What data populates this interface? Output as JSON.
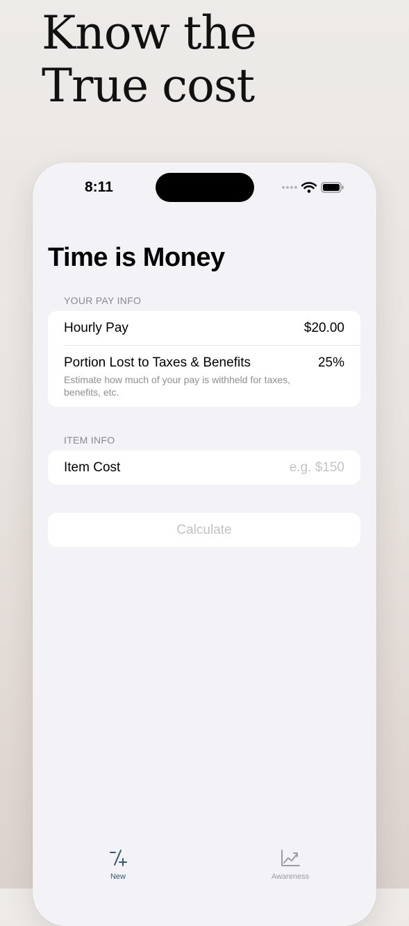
{
  "headline": {
    "line1": "Know the",
    "line2": "True cost"
  },
  "status_bar": {
    "time": "8:11"
  },
  "app": {
    "title": "Time is Money",
    "pay_section": {
      "header": "YOUR PAY INFO",
      "hourly_pay": {
        "label": "Hourly Pay",
        "value": "$20.00"
      },
      "tax_portion": {
        "label": "Portion Lost to Taxes & Benefits",
        "value": "25%",
        "description": "Estimate how much of your pay is withheld for taxes, benefits, etc."
      }
    },
    "item_section": {
      "header": "ITEM INFO",
      "item_cost": {
        "label": "Item Cost",
        "placeholder": "e.g. $150"
      }
    },
    "calculate_label": "Calculate"
  },
  "tab_bar": {
    "tabs": [
      {
        "label": "New",
        "icon": "plus-minus-icon",
        "selected": true
      },
      {
        "label": "Awareness",
        "icon": "chart-trend-icon",
        "selected": false
      }
    ]
  },
  "colors": {
    "accent": "#36586e",
    "background": "#f2f2f7",
    "inactive": "#9b9ba0"
  }
}
